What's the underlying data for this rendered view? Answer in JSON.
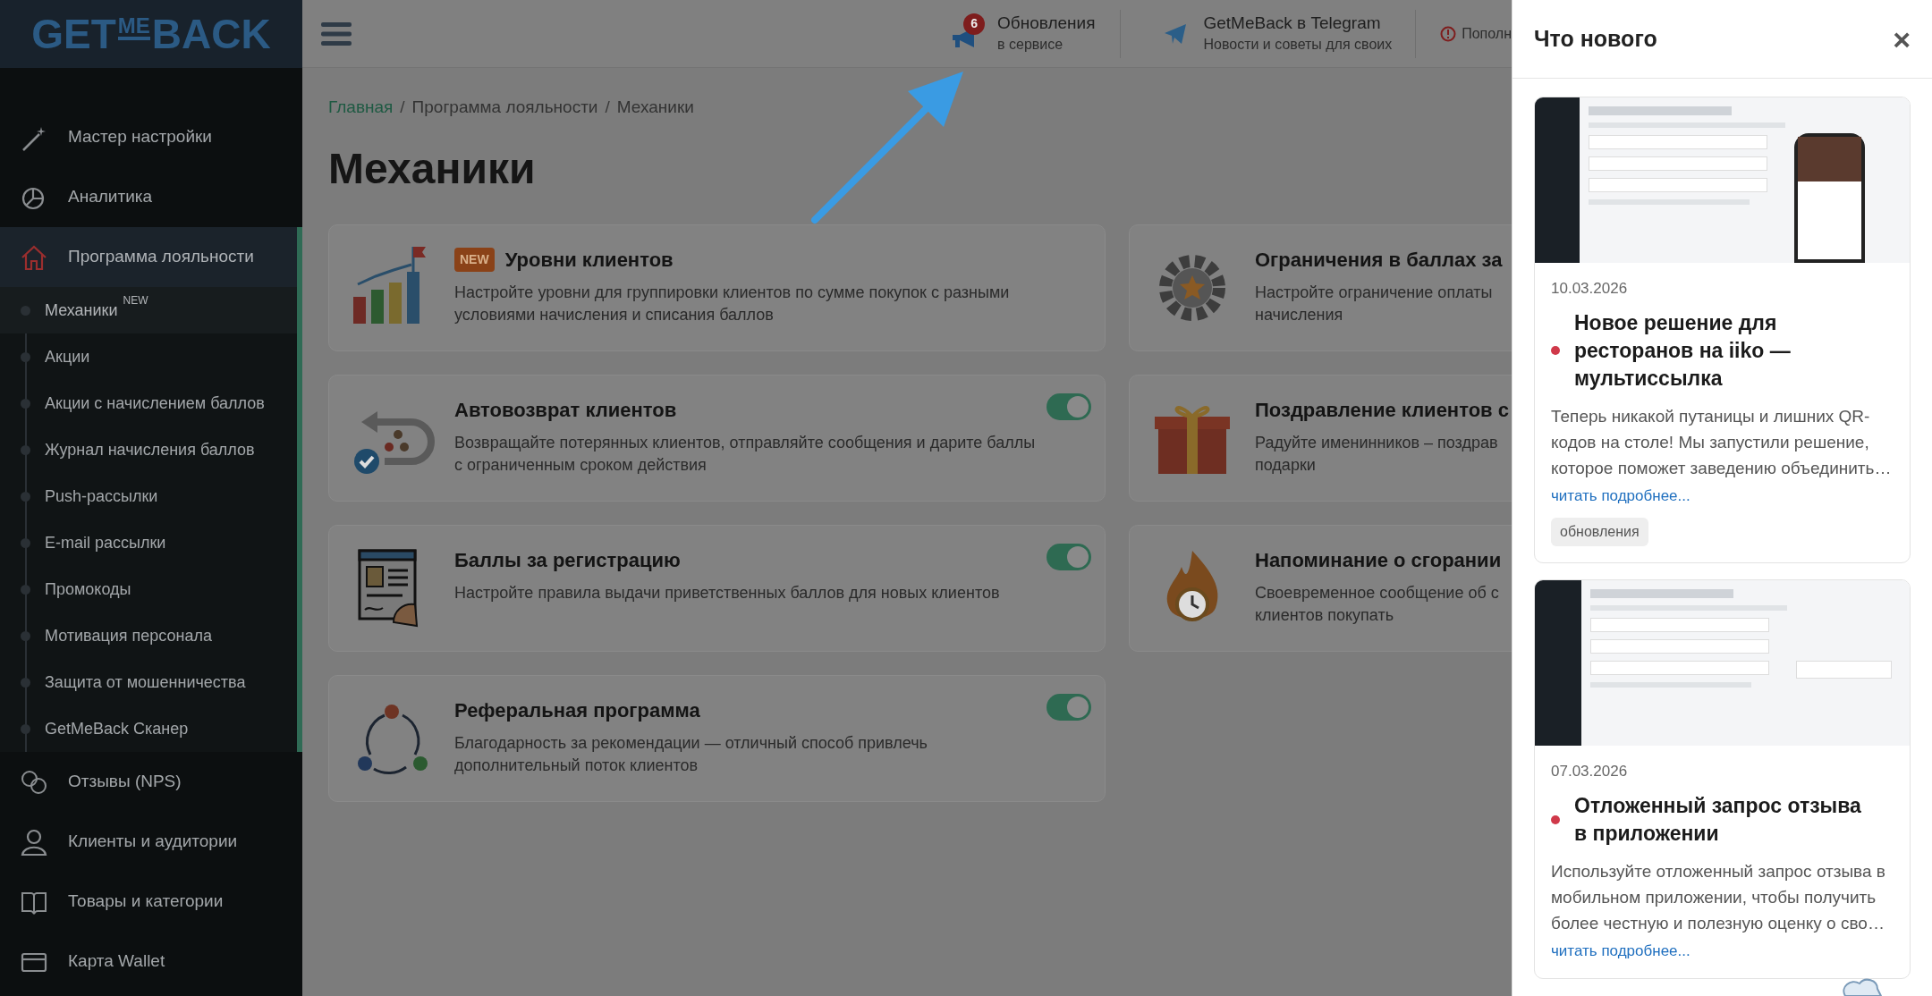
{
  "logo": {
    "parts": [
      "GET",
      "ME",
      "BACK"
    ]
  },
  "sidebar": {
    "items": [
      {
        "label": "Мастер настройки",
        "selected": false
      },
      {
        "label": "Аналитика",
        "selected": false
      },
      {
        "label": "Программа лояльности",
        "selected": true,
        "expanded": true,
        "children": [
          {
            "label": "Механики",
            "badge": "NEW",
            "selected": true
          },
          {
            "label": "Акции",
            "selected": false
          },
          {
            "label": "Акции с начислением баллов",
            "selected": false
          },
          {
            "label": "Журнал начисления баллов",
            "selected": false
          },
          {
            "label": "Push-рассылки",
            "selected": false
          },
          {
            "label": "E-mail рассылки",
            "selected": false
          },
          {
            "label": "Промокоды",
            "selected": false
          },
          {
            "label": "Мотивация персонала",
            "selected": false
          },
          {
            "label": "Защита от мошенничества",
            "selected": false
          },
          {
            "label": "GetMeBack Сканер",
            "selected": false
          }
        ]
      },
      {
        "label": "Отзывы (NPS)",
        "selected": false
      },
      {
        "label": "Клиенты и аудитории",
        "selected": false
      },
      {
        "label": "Товары и категории",
        "selected": false
      },
      {
        "label": "Карта Wallet",
        "selected": false
      }
    ]
  },
  "header": {
    "updates": {
      "badge": "6",
      "title": "Обновления",
      "subtitle": "в сервисе"
    },
    "telegram": {
      "title": "GetMeBack в Telegram",
      "subtitle": "Новости и советы для своих"
    },
    "alert": {
      "label": "Пополн"
    }
  },
  "breadcrumbs": [
    {
      "label": "Главная"
    },
    {
      "separator": "/",
      "label": "Программа лояльности"
    },
    {
      "separator": "/",
      "label": "Механики"
    }
  ],
  "page_title": "Механики",
  "cards": [
    {
      "title": "Уровни клиентов",
      "badge": "NEW",
      "description_lines": [
        "Настройте уровни для группировки клиентов по сумме покупок с разными",
        "условиями начисления и списания баллов"
      ]
    },
    {
      "title": "Ограничения в баллах за",
      "description_lines": [
        "Настройте ограничение оплаты",
        "начисления"
      ]
    },
    {
      "title": "Автовозврат клиентов",
      "toggle": {
        "on": true
      },
      "description_lines": [
        "Возвращайте потерянных клиентов, отправляйте сообщения и дарите баллы",
        "с ограниченным сроком действия"
      ]
    },
    {
      "title": "Поздравление клиентов с",
      "description_lines": [
        "Радуйте именинников – поздрав",
        "подарки"
      ]
    },
    {
      "title": "Баллы за регистрацию",
      "toggle": {
        "on": true
      },
      "description_lines": [
        "Настройте правила выдачи приветственных баллов для новых клиентов"
      ]
    },
    {
      "title": "Напоминание о сгорании",
      "description_lines": [
        "Своевременное сообщение об с",
        "клиентов покупать"
      ]
    },
    {
      "title": "Реферальная программа",
      "toggle": {
        "on": true
      },
      "description_lines": [
        "Благодарность за рекомендации — отличный способ привлечь",
        "дополнительный поток клиентов"
      ]
    }
  ],
  "drawer": {
    "title": "Что нового",
    "close": "×",
    "posts": [
      {
        "date": "10.03.2026",
        "unread": true,
        "title": "Новое решение для ресторанов на iiko — мультиссылка",
        "description": "Теперь никакой путаницы и лишних QR-кодов на столе! Мы запустили решение, которое поможет заведению объединить…",
        "link": "читать подробнее...",
        "tag": "обновления"
      },
      {
        "date": "07.03.2026",
        "unread": true,
        "title": "Отложенный запрос отзыва в приложении",
        "description": "Используйте отложенный запрос отзыва в мобильном приложении, чтобы получить более честную и полезную оценку о сво…",
        "link": "читать подробнее..."
      }
    ]
  }
}
